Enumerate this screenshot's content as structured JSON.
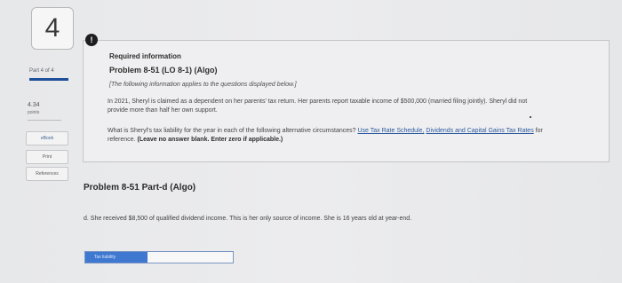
{
  "question_number": "4",
  "part_indicator": "Part 4 of 4",
  "points": {
    "value": "4.34",
    "label": "points"
  },
  "side_buttons": {
    "ebook": "eBook",
    "print": "Print",
    "references": "References"
  },
  "alert_icon": "!",
  "info": {
    "required_title": "Required information",
    "problem_title": "Problem 8-51 (LO 8-1) (Algo)",
    "applies_note": "[The following information applies to the questions displayed below.]",
    "body": "In 2021, Sheryl is claimed as a dependent on her parents' tax return. Her parents report taxable income of $500,000 (married filing jointly). Sheryl did not provide more than half her own support.",
    "question_prefix": "What is Sheryl's tax liability for the year in each of the following alternative circumstances?",
    "link_tax_rate": "Use Tax Rate Schedule,",
    "link_dividends": "Dividends and Capital Gains Tax Rates",
    "question_suffix": "for reference.",
    "instruction": "(Leave no answer blank. Enter zero if applicable.)"
  },
  "part_d": {
    "title": "Problem 8-51 Part-d (Algo)",
    "text": "d. She received $8,500 of qualified dividend income. This is her only source of income. She is 16 years old at year-end."
  },
  "answer": {
    "label": "Tax liability",
    "value": ""
  },
  "colors": {
    "accent_blue": "#1e4f9a",
    "input_label_blue": "#3e78d1",
    "link": "#2c5a9e"
  }
}
